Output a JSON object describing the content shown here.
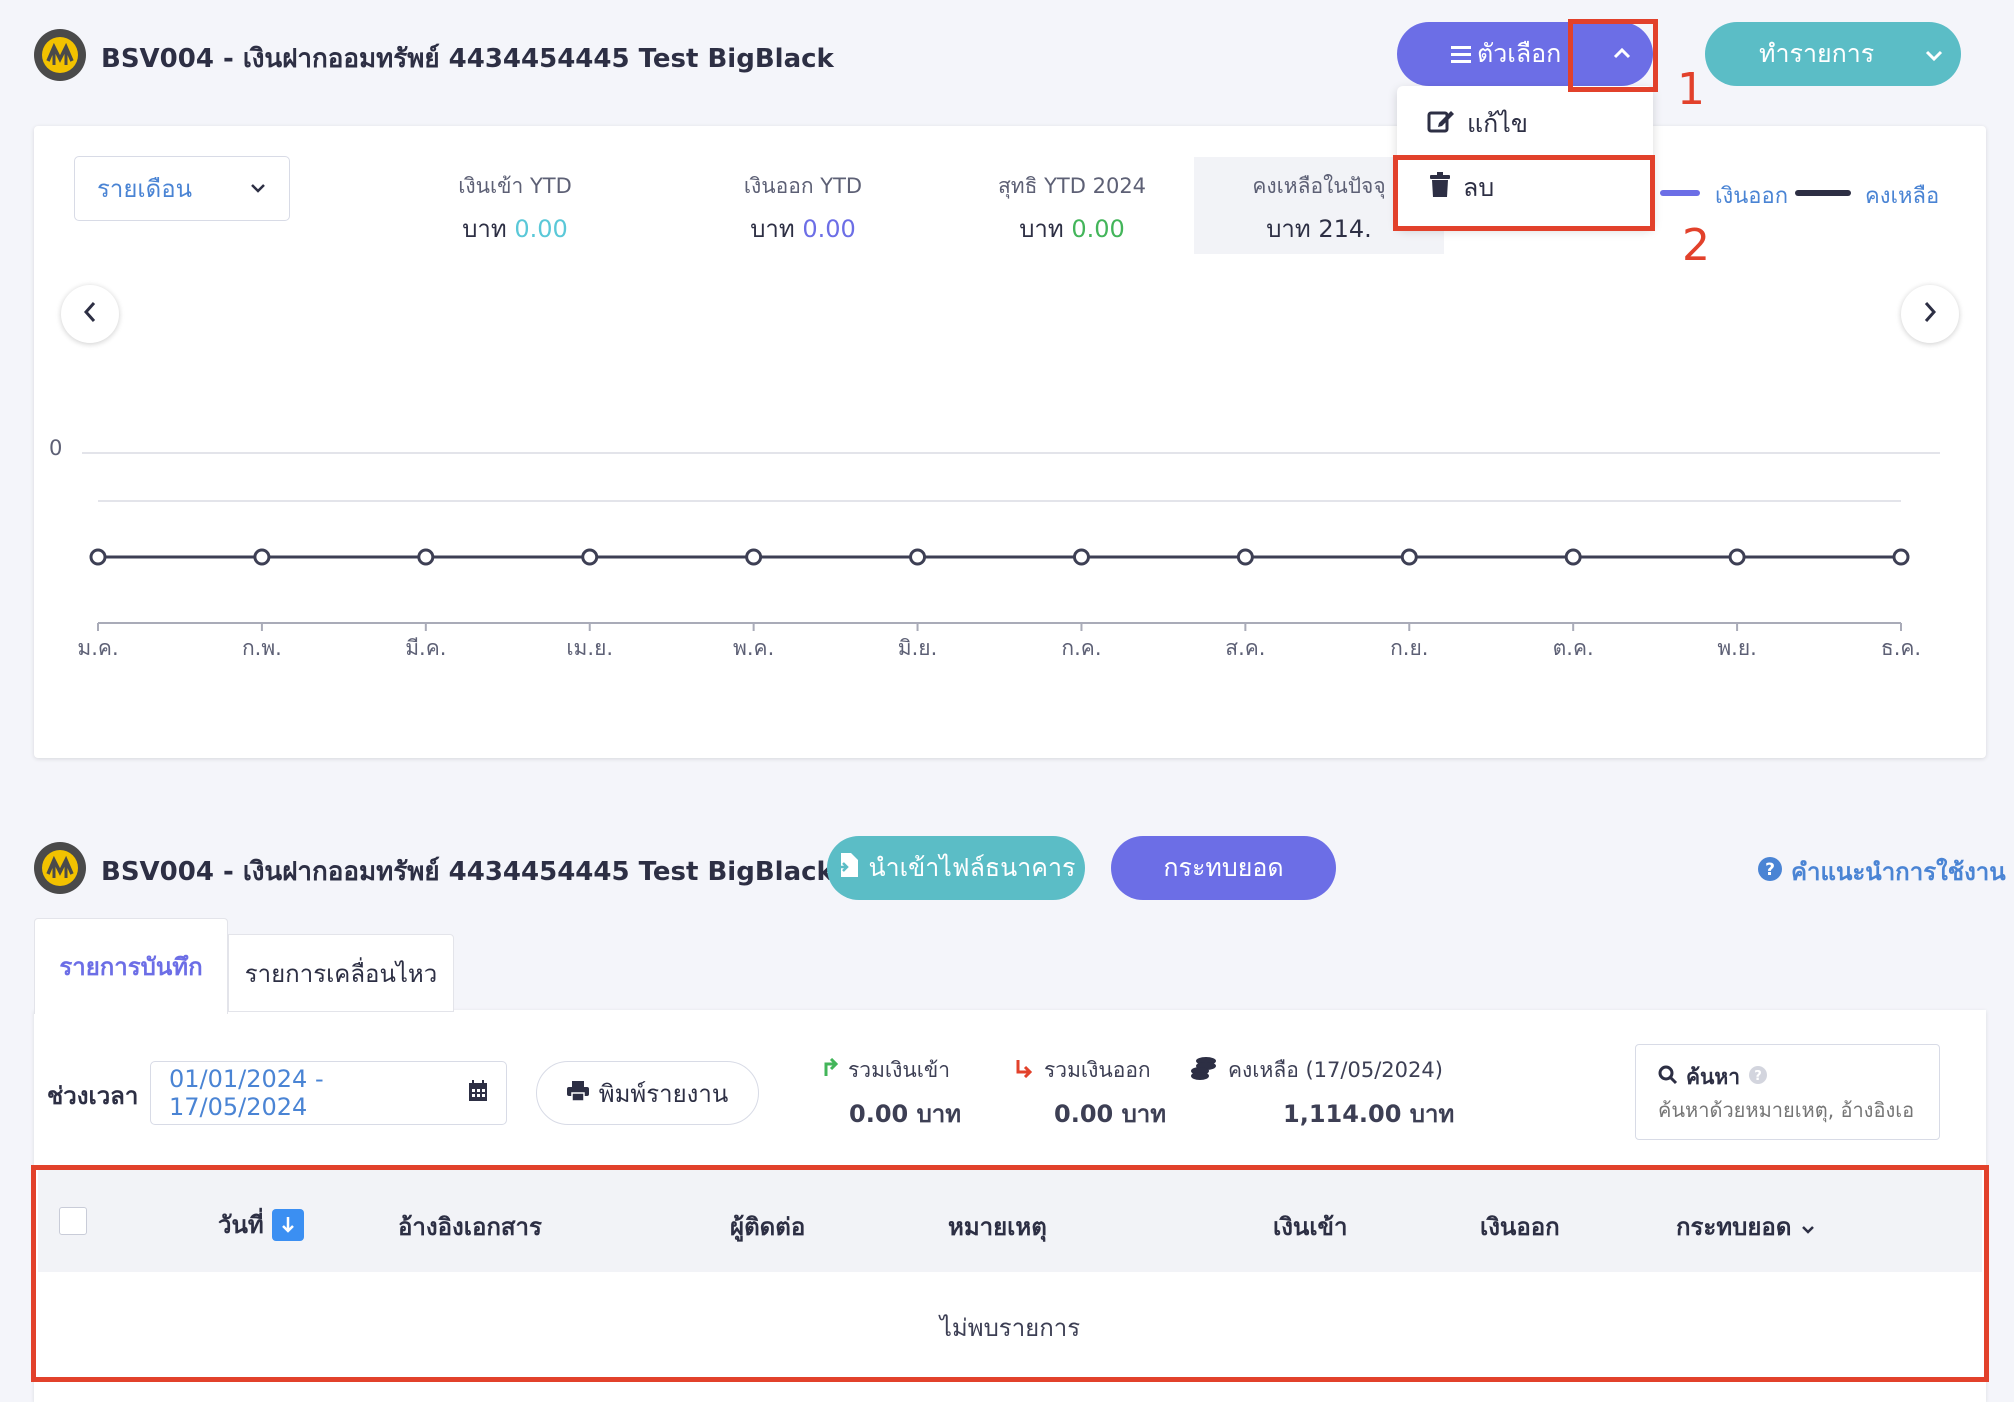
{
  "header": {
    "account_title": "BSV004 - เงินฝากออมทรัพย์ 4434454445 Test BigBlack",
    "options_button": "ตัวเลือก",
    "transaction_button": "ทำรายการ"
  },
  "options_menu": {
    "items": [
      {
        "label": "แก้ไข",
        "icon": "edit-icon"
      },
      {
        "label": "ลบ",
        "icon": "trash-icon"
      }
    ]
  },
  "annotations": {
    "step1": "1",
    "step2": "2"
  },
  "summary": {
    "period_select": "รายเดือน",
    "stats": [
      {
        "label": "เงินเข้า YTD",
        "prefix": "บาท",
        "value": "0.00",
        "color": "#5ac8d8"
      },
      {
        "label": "เงินออก YTD",
        "prefix": "บาท",
        "value": "0.00",
        "color": "#6c6ee6"
      },
      {
        "label": "สุทธิ YTD 2024",
        "prefix": "บาท",
        "value": "0.00",
        "color": "#43b55a"
      },
      {
        "label": "คงเหลือในปัจจุ",
        "prefix": "บาท",
        "value": "214.",
        "color": "#2d2f44"
      }
    ],
    "legend": [
      {
        "label": "เงินออก",
        "color": "#6c6ee6"
      },
      {
        "label": "คงเหลือ",
        "color": "#2d2f44"
      }
    ]
  },
  "chart_data": {
    "type": "line",
    "categories": [
      "ม.ค.",
      "ก.พ.",
      "มี.ค.",
      "เม.ย.",
      "พ.ค.",
      "มิ.ย.",
      "ก.ค.",
      "ส.ค.",
      "ก.ย.",
      "ต.ค.",
      "พ.ย.",
      "ธ.ค."
    ],
    "series": [
      {
        "name": "คงเหลือ",
        "values": [
          0,
          0,
          0,
          0,
          0,
          0,
          0,
          0,
          0,
          0,
          0,
          0
        ]
      }
    ],
    "yticks": [
      "0"
    ],
    "title": "",
    "xlabel": "",
    "ylabel": ""
  },
  "ledger": {
    "account_title": "BSV004 - เงินฝากออมทรัพย์ 4434454445 Test BigBlack",
    "import_button": "นำเข้าไฟล์ธนาคาร",
    "reconcile_button": "กระทบยอด",
    "help_link": "คำแนะนำการใช้งาน",
    "tabs": [
      "รายการบันทึก",
      "รายการเคลื่อนไหว"
    ],
    "period_label": "ช่วงเวลา",
    "date_range": "01/01/2024 - 17/05/2024",
    "print_button": "พิมพ์รายงาน",
    "totals": [
      {
        "label": "รวมเงินเข้า",
        "value": "0.00 บาท"
      },
      {
        "label": "รวมเงินออก",
        "value": "0.00 บาท"
      },
      {
        "label": "คงเหลือ (17/05/2024)",
        "value": "1,114.00 บาท"
      }
    ],
    "search_label": "ค้นหา",
    "search_placeholder": "ค้นหาด้วยหมายเหตุ, อ้างอิงเอ",
    "columns": [
      "วันที่",
      "อ้างอิงเอกสาร",
      "ผู้ติดต่อ",
      "หมายเหตุ",
      "เงินเข้า",
      "เงินออก",
      "กระทบยอด"
    ],
    "empty_text": "ไม่พบรายการ"
  }
}
